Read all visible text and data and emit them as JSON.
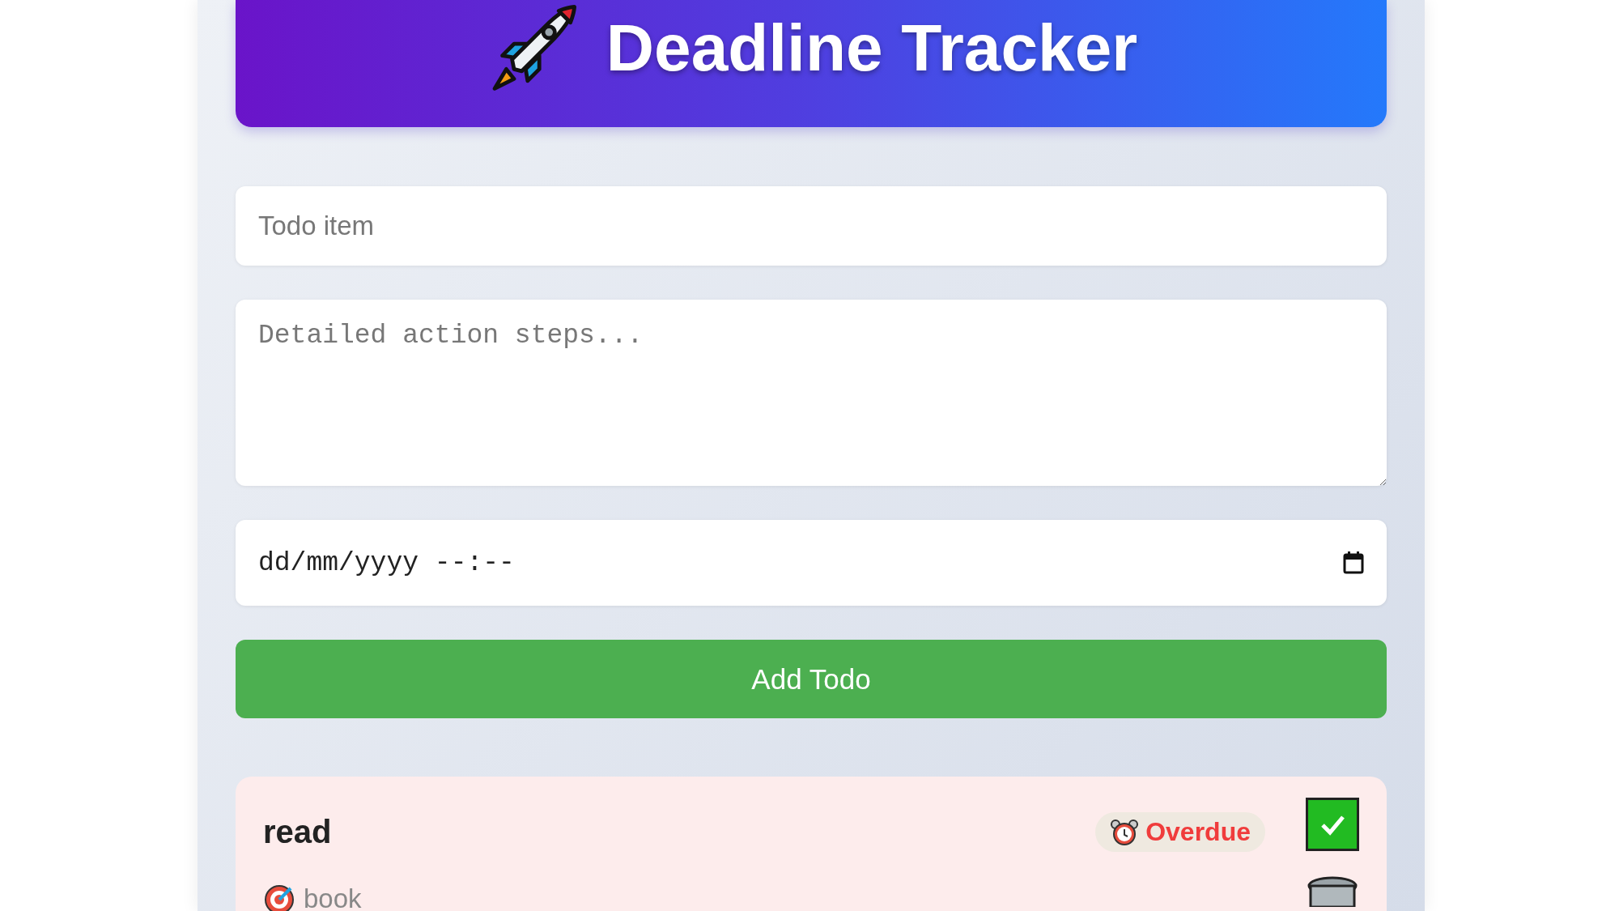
{
  "header": {
    "title": "Deadline Tracker"
  },
  "form": {
    "todo_placeholder": "Todo item",
    "steps_placeholder": "Detailed action steps...",
    "date_value": "dd/mm/yyyy --:--",
    "submit_label": "Add Todo"
  },
  "todos": [
    {
      "title": "read",
      "note": "book",
      "overdue": true,
      "status_label": "Overdue"
    }
  ]
}
